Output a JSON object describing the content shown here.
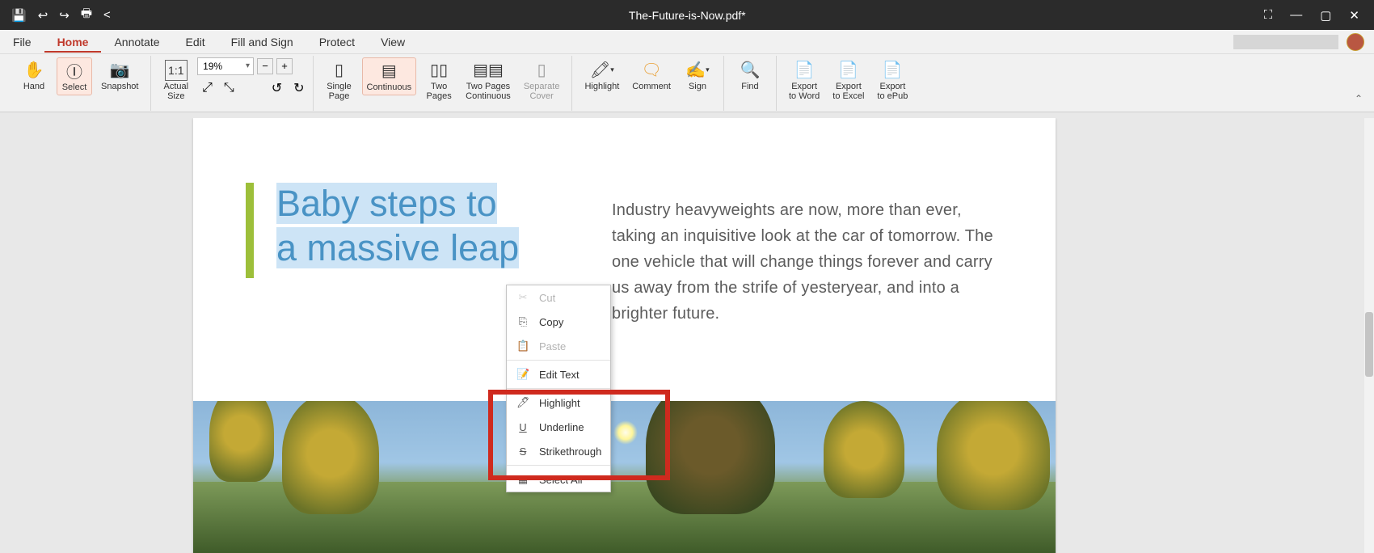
{
  "titlebar": {
    "title": "The-Future-is-Now.pdf*"
  },
  "menubar": {
    "items": [
      "File",
      "Home",
      "Annotate",
      "Edit",
      "Fill and Sign",
      "Protect",
      "View"
    ],
    "active": 1
  },
  "ribbon": {
    "hand": "Hand",
    "select": "Select",
    "snapshot": "Snapshot",
    "actual_size": "Actual\nSize",
    "zoom_value": "19%",
    "single_page": "Single\nPage",
    "continuous": "Continuous",
    "two_pages": "Two\nPages",
    "two_pages_cont": "Two Pages\nContinuous",
    "separate_cover": "Separate\nCover",
    "highlight": "Highlight",
    "comment": "Comment",
    "sign": "Sign",
    "find": "Find",
    "export_word": "Export\nto Word",
    "export_excel": "Export\nto Excel",
    "export_epub": "Export\nto ePub"
  },
  "document": {
    "heading_line1": "Baby steps to",
    "heading_line2": "a massive leap",
    "body": "Industry heavyweights are now, more than ever, taking an inquisitive look at the car of tomorrow. The one vehicle that will change things forever and carry us away from the strife of yesteryear, and into a brighter future."
  },
  "context_menu": {
    "cut": "Cut",
    "copy": "Copy",
    "paste": "Paste",
    "edit_text": "Edit Text",
    "highlight": "Highlight",
    "underline": "Underline",
    "strikethrough": "Strikethrough",
    "select_all": "Select All"
  }
}
